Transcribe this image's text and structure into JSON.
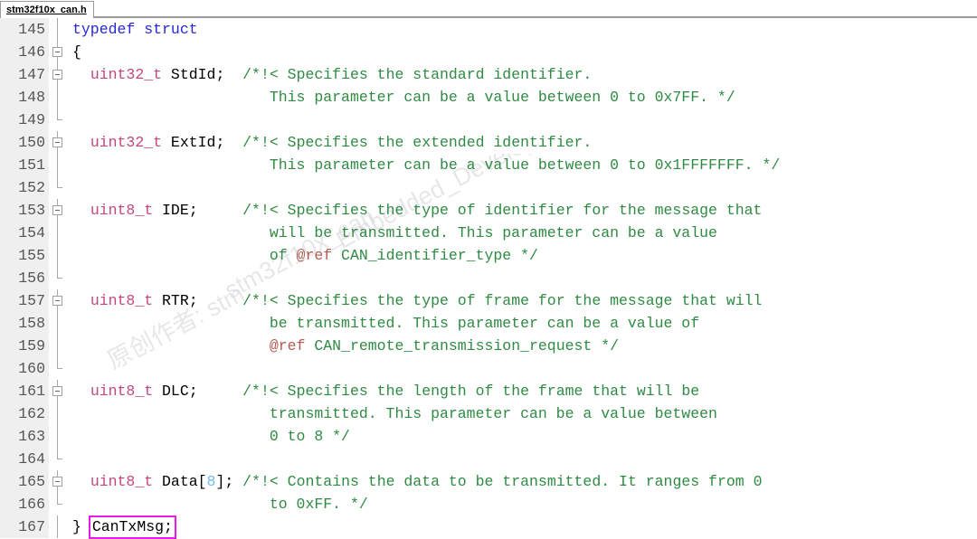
{
  "window": {
    "tab_label": "stm32f10x_can.h"
  },
  "watermark": {
    "line1": "原创作者: stm",
    "line2": "stm32f10x_can",
    "line3": "Embedded_Develop"
  },
  "editor": {
    "highlight_color": "#e81ae8",
    "keyword_color": "#2727d6",
    "type_color": "#c2477d",
    "comment_color": "#2f8a43",
    "ref_color": "#b05a50",
    "number_color": "#6fb5e8",
    "lines": [
      {
        "number": "145",
        "fold": "line",
        "tokens": [
          {
            "t": "typedef struct",
            "c": "kw"
          }
        ]
      },
      {
        "number": "146",
        "fold": "box",
        "tokens": [
          {
            "t": "{",
            "c": "plain"
          }
        ]
      },
      {
        "number": "147",
        "fold": "box",
        "tokens": [
          {
            "t": "  ",
            "c": "plain"
          },
          {
            "t": "uint32_t",
            "c": "type"
          },
          {
            "t": " StdId;  ",
            "c": "plain"
          },
          {
            "t": "/*!< Specifies the standard identifier.",
            "c": "cmt"
          }
        ]
      },
      {
        "number": "148",
        "fold": "line",
        "tokens": [
          {
            "t": "                      This parameter can be a value between 0 to 0x7FF. */",
            "c": "cmt"
          }
        ]
      },
      {
        "number": "149",
        "fold": "tick",
        "tokens": []
      },
      {
        "number": "150",
        "fold": "box",
        "tokens": [
          {
            "t": "  ",
            "c": "plain"
          },
          {
            "t": "uint32_t",
            "c": "type"
          },
          {
            "t": " ExtId;  ",
            "c": "plain"
          },
          {
            "t": "/*!< Specifies the extended identifier.",
            "c": "cmt"
          }
        ]
      },
      {
        "number": "151",
        "fold": "line",
        "tokens": [
          {
            "t": "                      This parameter can be a value between 0 to 0x1FFFFFFF. */",
            "c": "cmt"
          }
        ]
      },
      {
        "number": "152",
        "fold": "tick",
        "tokens": []
      },
      {
        "number": "153",
        "fold": "box",
        "tokens": [
          {
            "t": "  ",
            "c": "plain"
          },
          {
            "t": "uint8_t",
            "c": "type"
          },
          {
            "t": " IDE;     ",
            "c": "plain"
          },
          {
            "t": "/*!< Specifies the type of identifier for the message that",
            "c": "cmt"
          }
        ]
      },
      {
        "number": "154",
        "fold": "line",
        "tokens": [
          {
            "t": "                      will be transmitted. This parameter can be a value",
            "c": "cmt"
          }
        ]
      },
      {
        "number": "155",
        "fold": "line",
        "tokens": [
          {
            "t": "                      of ",
            "c": "cmt"
          },
          {
            "t": "@ref",
            "c": "ref"
          },
          {
            "t": " CAN_identifier_type */",
            "c": "cmt"
          }
        ]
      },
      {
        "number": "156",
        "fold": "tick",
        "tokens": []
      },
      {
        "number": "157",
        "fold": "box",
        "tokens": [
          {
            "t": "  ",
            "c": "plain"
          },
          {
            "t": "uint8_t",
            "c": "type"
          },
          {
            "t": " RTR;     ",
            "c": "plain"
          },
          {
            "t": "/*!< Specifies the type of frame for the message that will",
            "c": "cmt"
          }
        ]
      },
      {
        "number": "158",
        "fold": "line",
        "tokens": [
          {
            "t": "                      be transmitted. This parameter can be a value of",
            "c": "cmt"
          }
        ]
      },
      {
        "number": "159",
        "fold": "line",
        "tokens": [
          {
            "t": "                      ",
            "c": "cmt"
          },
          {
            "t": "@ref",
            "c": "ref"
          },
          {
            "t": " CAN_remote_transmission_request */",
            "c": "cmt"
          }
        ]
      },
      {
        "number": "160",
        "fold": "tick",
        "tokens": []
      },
      {
        "number": "161",
        "fold": "box",
        "tokens": [
          {
            "t": "  ",
            "c": "plain"
          },
          {
            "t": "uint8_t",
            "c": "type"
          },
          {
            "t": " DLC;     ",
            "c": "plain"
          },
          {
            "t": "/*!< Specifies the length of the frame that will be",
            "c": "cmt"
          }
        ]
      },
      {
        "number": "162",
        "fold": "line",
        "tokens": [
          {
            "t": "                      transmitted. This parameter can be a value between",
            "c": "cmt"
          }
        ]
      },
      {
        "number": "163",
        "fold": "line",
        "tokens": [
          {
            "t": "                      0 to 8 */",
            "c": "cmt"
          }
        ]
      },
      {
        "number": "164",
        "fold": "tick",
        "tokens": []
      },
      {
        "number": "165",
        "fold": "box",
        "tokens": [
          {
            "t": "  ",
            "c": "plain"
          },
          {
            "t": "uint8_t",
            "c": "type"
          },
          {
            "t": " Data[",
            "c": "plain"
          },
          {
            "t": "8",
            "c": "num"
          },
          {
            "t": "]; ",
            "c": "plain"
          },
          {
            "t": "/*!< Contains the data to be transmitted. It ranges from 0",
            "c": "cmt"
          }
        ]
      },
      {
        "number": "166",
        "fold": "tick",
        "tokens": [
          {
            "t": "                      to 0xFF. */",
            "c": "cmt"
          }
        ]
      },
      {
        "number": "167",
        "fold": "line",
        "tokens": [
          {
            "t": "} ",
            "c": "plain"
          },
          {
            "t": "CanTxMsg;",
            "c": "plain",
            "highlight": true
          }
        ]
      }
    ]
  }
}
